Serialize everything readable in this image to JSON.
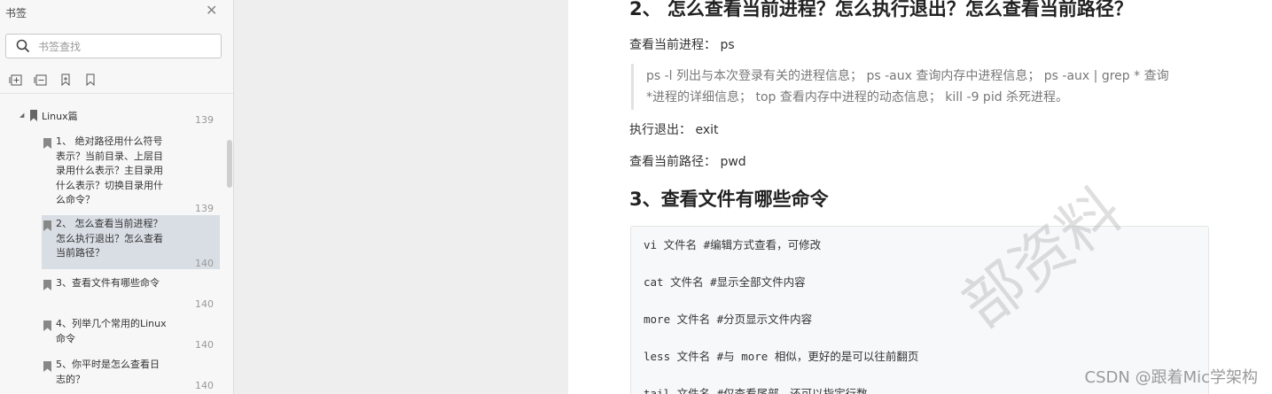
{
  "sidebar": {
    "title": "书签",
    "search_placeholder": "书签查找",
    "tree_root": {
      "label": "Linux篇",
      "page": "139"
    },
    "items": [
      {
        "label": "1、 绝对路径用什么符号表示？当前目录、上层目录用什么表示？主目录用什么表示？切换目录用什么命令？",
        "page": "139"
      },
      {
        "label": "2、 怎么查看当前进程？怎么执行退出？怎么查看当前路径？",
        "page": "140"
      },
      {
        "label": "3、查看文件有哪些命令",
        "page": "140"
      },
      {
        "label": "4、列举几个常用的Linux命令",
        "page": "140"
      },
      {
        "label": "5、你平时是怎么查看日志的？",
        "page": "140"
      }
    ]
  },
  "doc": {
    "heading2": "2、 怎么查看当前进程？怎么执行退出？怎么查看当前路径？",
    "view_process": "查看当前进程： ps",
    "quote_line1": "ps -l 列出与本次登录有关的进程信息； ps -aux 查询内存中进程信息； ps -aux | grep * 查询",
    "quote_line2": "*进程的详细信息； top 查看内存中进程的动态信息； kill -9 pid 杀死进程。",
    "exit": "执行退出： exit",
    "view_path": "查看当前路径： pwd",
    "heading3": "3、查看文件有哪些命令",
    "code_lines": [
      "vi 文件名 #编辑方式查看，可修改",
      "cat 文件名 #显示全部文件内容",
      "more 文件名 #分页显示文件内容",
      "less 文件名 #与 more 相似，更好的是可以往前翻页",
      "tail 文件名 #仅查看尾部，还可以指定行数"
    ],
    "watermark": "部资料",
    "footer_credit": "CSDN @跟着Mic学架构"
  },
  "colors": {
    "sidebar_bg": "#f7f7f7",
    "selected_bg": "#d9dee5",
    "code_bg": "#f6f8fa"
  },
  "icons": [
    "close-icon",
    "search-icon",
    "add-bookmark-icon",
    "expand-all-icon",
    "bookmark-icon",
    "bookmark-outline-icon"
  ]
}
